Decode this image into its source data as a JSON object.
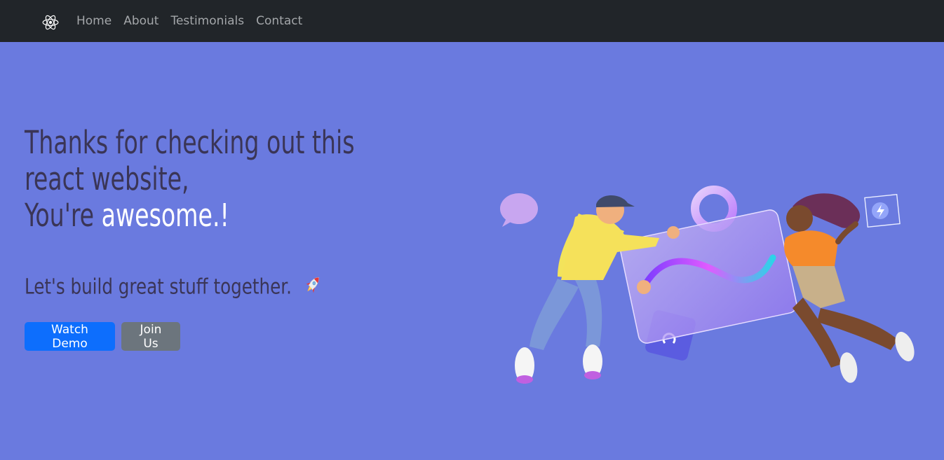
{
  "navbar": {
    "logo_icon": "react-atom-icon",
    "links": [
      "Home",
      "About",
      "Testimonials",
      "Contact"
    ]
  },
  "hero": {
    "headline_line1": "Thanks for checking out this react website,",
    "headline_prefix": "You're ",
    "headline_accent": "awesome.!",
    "tagline": "Let's build great stuff together.",
    "tagline_icon": "rocket-icon",
    "buttons": {
      "primary": "Watch Demo",
      "secondary": "Join Us"
    },
    "illustration": "people-with-glass-card-illustration"
  },
  "colors": {
    "navbar_bg": "#212529",
    "hero_bg": "#6a7adf",
    "headline_text": "#3a3556",
    "accent_text": "#ffffff",
    "primary_button": "#0d6efd",
    "secondary_button": "#6c757d"
  }
}
